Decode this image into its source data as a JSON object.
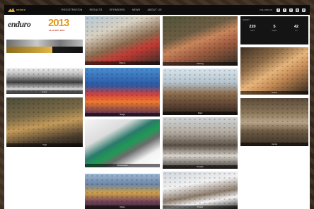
{
  "brand": {
    "logo_text": "enduro"
  },
  "nav": [
    "REGISTRATION",
    "RESULTS",
    "SPONSORS",
    "NEWS",
    "ABOUT US"
  ],
  "social": {
    "label": "FOLLOW US",
    "icons": [
      "f",
      "t",
      "y",
      "g",
      "p"
    ]
  },
  "tiles": {
    "logo": {
      "brand1": "enduro",
      "brand2": "2013",
      "dates": "10-12 MAY 2013"
    },
    "captions": {
      "moto1": "Riders",
      "mtn1": "Trail",
      "crowd": "Fans",
      "stage": "Stage",
      "dirt": "Racing",
      "riders": "Start",
      "bands": "Wristbands",
      "parade": "Parade",
      "valley": "Valley",
      "snow": "Peaks",
      "slope": "Climb",
      "camp": "Camp"
    }
  },
  "stats": {
    "label": "EVENT",
    "items": [
      {
        "num": "220",
        "sub": "riders"
      },
      {
        "num": "5",
        "sub": "stages"
      },
      {
        "num": "42",
        "sub": "km"
      }
    ]
  }
}
